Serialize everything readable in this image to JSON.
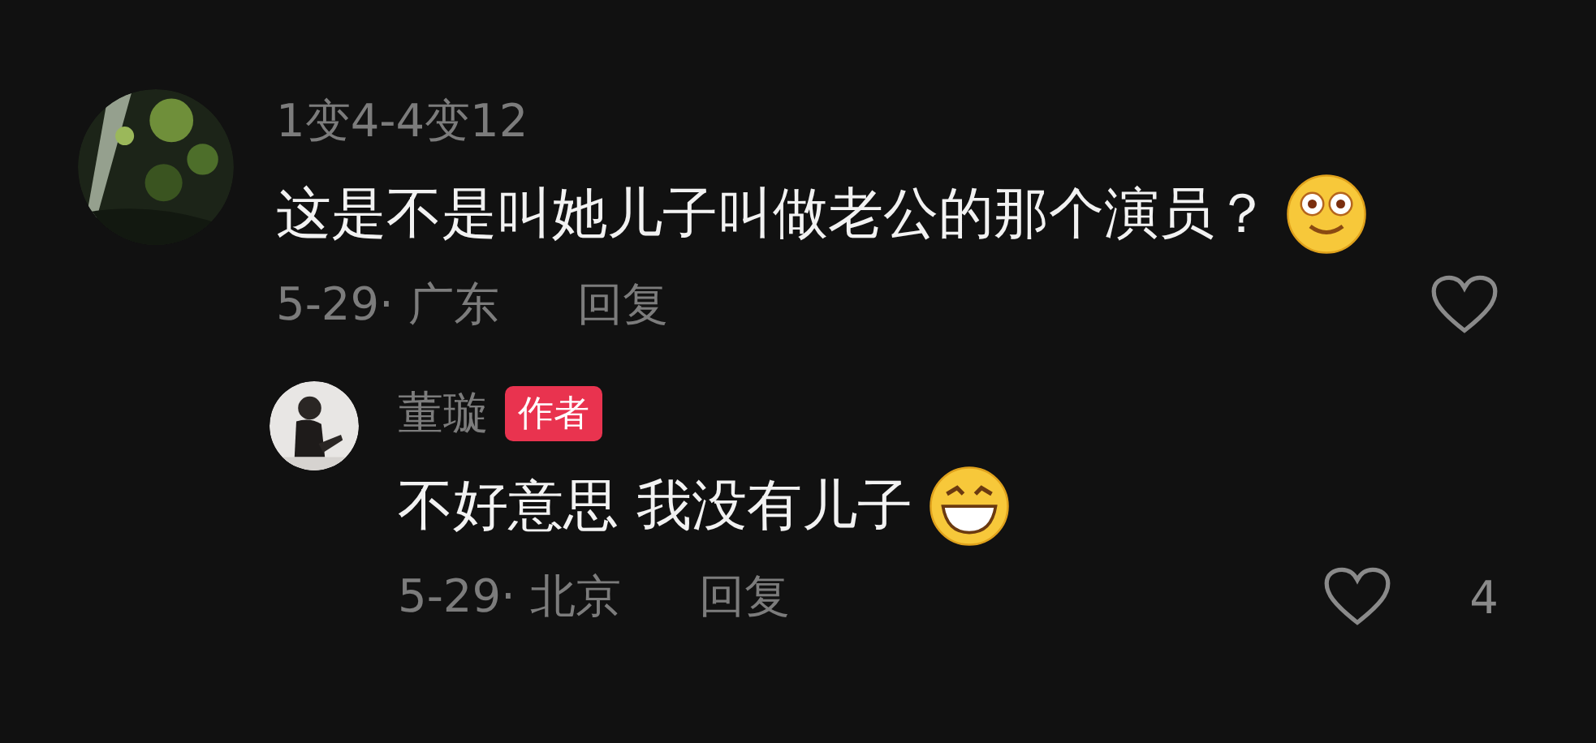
{
  "comments": [
    {
      "author": "1变4-4变12",
      "text": "这是不是叫她儿子叫做老公的那个演员？",
      "emoji": {
        "kind": "smile"
      },
      "date": "5-29·",
      "location": "广东",
      "reply_label": "回复",
      "children": [
        {
          "author": "董璇",
          "badge": "作者",
          "text": "不好意思 我没有儿子",
          "emoji": {
            "kind": "grin"
          },
          "date": "5-29·",
          "location": "北京",
          "reply_label": "回复",
          "likes": "4"
        }
      ]
    }
  ]
}
